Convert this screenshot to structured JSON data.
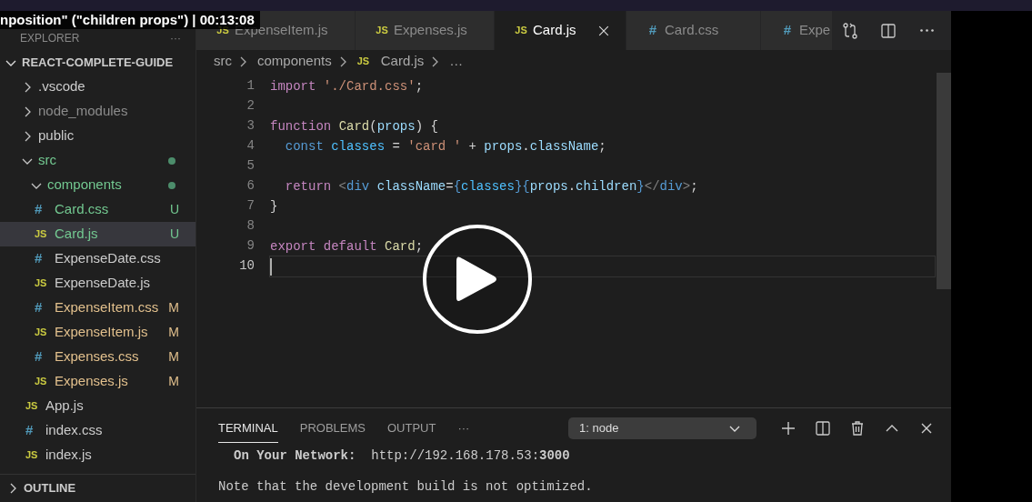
{
  "video_title": "nposition\" (\"children props\") | 00:13:08",
  "explorer": {
    "title": "EXPLORER",
    "more": "···",
    "project": {
      "name": "REACT-COMPLETE-GUIDE",
      "expanded": true,
      "children": [
        {
          "name": ".vscode",
          "kind": "folder",
          "expanded": false,
          "color": "#cccccc",
          "changes_dot": false,
          "selected": false
        },
        {
          "name": "node_modules",
          "kind": "folder",
          "expanded": false,
          "color": "#8c8c8c",
          "changes_dot": false,
          "selected": false
        },
        {
          "name": "public",
          "kind": "folder",
          "expanded": false,
          "color": "#cccccc",
          "changes_dot": false,
          "selected": false
        },
        {
          "name": "src",
          "kind": "folder",
          "expanded": true,
          "color": "#73c991",
          "changes_dot": true,
          "selected": false,
          "children": [
            {
              "name": "components",
              "kind": "folder",
              "expanded": true,
              "color": "#73c991",
              "changes_dot": true,
              "selected": false,
              "children": [
                {
                  "name": "Card.css",
                  "kind": "css",
                  "icon": "#",
                  "color": "#73c991",
                  "status": "U",
                  "selected": false
                },
                {
                  "name": "Card.js",
                  "kind": "js",
                  "icon": "JS",
                  "color": "#73c991",
                  "status": "U",
                  "selected": true
                },
                {
                  "name": "ExpenseDate.css",
                  "kind": "css",
                  "icon": "#",
                  "color": "#cccccc",
                  "selected": false
                },
                {
                  "name": "ExpenseDate.js",
                  "kind": "js",
                  "icon": "JS",
                  "color": "#cccccc",
                  "selected": false
                },
                {
                  "name": "ExpenseItem.css",
                  "kind": "css",
                  "icon": "#",
                  "color": "#e2c08d",
                  "status": "M",
                  "selected": false
                },
                {
                  "name": "ExpenseItem.js",
                  "kind": "js",
                  "icon": "JS",
                  "color": "#e2c08d",
                  "status": "M",
                  "selected": false
                },
                {
                  "name": "Expenses.css",
                  "kind": "css",
                  "icon": "#",
                  "color": "#e2c08d",
                  "status": "M",
                  "selected": false
                },
                {
                  "name": "Expenses.js",
                  "kind": "js",
                  "icon": "JS",
                  "color": "#e2c08d",
                  "status": "M",
                  "selected": false
                }
              ]
            },
            {
              "name": "App.js",
              "kind": "js",
              "icon": "JS",
              "color": "#cccccc",
              "selected": false
            },
            {
              "name": "index.css",
              "kind": "css",
              "icon": "#",
              "color": "#cccccc",
              "selected": false
            },
            {
              "name": "index.js",
              "kind": "js",
              "icon": "JS",
              "color": "#cccccc",
              "selected": false
            }
          ]
        }
      ]
    }
  },
  "outline": {
    "title": "OUTLINE",
    "expanded": false
  },
  "tabs": [
    {
      "label": "ExpenseItem.js",
      "kind": "js",
      "icon": "JS",
      "selected": false
    },
    {
      "label": "Expenses.js",
      "kind": "js",
      "icon": "JS",
      "selected": false
    },
    {
      "label": "Card.js",
      "kind": "js",
      "icon": "JS",
      "selected": true
    },
    {
      "label": "Card.css",
      "kind": "css",
      "icon": "#",
      "selected": false
    },
    {
      "label": "Expe",
      "kind": "css",
      "icon": "#",
      "selected": false
    }
  ],
  "breadcrumb": [
    {
      "label": "src"
    },
    {
      "label": "components"
    },
    {
      "label": "Card.js",
      "icon": "JS"
    },
    {
      "label": "…"
    }
  ],
  "code": [
    {
      "number": "1",
      "current": false,
      "indented": false,
      "tokens": [
        {
          "kind": "kw",
          "text": "import "
        },
        {
          "kind": "str",
          "text": "'./Card.css'"
        },
        {
          "kind": "plain",
          "text": ";"
        }
      ]
    },
    {
      "number": "2",
      "current": false
    },
    {
      "number": "3",
      "current": false,
      "indented": false,
      "tokens": [
        {
          "kind": "kw",
          "text": "function "
        },
        {
          "kind": "fn",
          "text": "Card"
        },
        {
          "kind": "plain",
          "text": "("
        },
        {
          "kind": "var",
          "text": "props"
        },
        {
          "kind": "plain",
          "text": ") {"
        }
      ]
    },
    {
      "number": "4",
      "current": false,
      "indented": true,
      "tokens": [
        {
          "kind": "decl",
          "text": "const "
        },
        {
          "kind": "const",
          "text": "classes"
        },
        {
          "kind": "plain",
          "text": " = "
        },
        {
          "kind": "str",
          "text": "'card '"
        },
        {
          "kind": "plain",
          "text": " + "
        },
        {
          "kind": "var",
          "text": "props"
        },
        {
          "kind": "plain",
          "text": "."
        },
        {
          "kind": "var",
          "text": "className"
        },
        {
          "kind": "plain",
          "text": ";"
        }
      ]
    },
    {
      "number": "5",
      "current": false
    },
    {
      "number": "6",
      "current": false,
      "indented": true,
      "tokens": [
        {
          "kind": "kw",
          "text": "return "
        },
        {
          "kind": "punct",
          "text": "<"
        },
        {
          "kind": "decl",
          "text": "div"
        },
        {
          "kind": "var",
          "text": " className"
        },
        {
          "kind": "plain",
          "text": "="
        },
        {
          "kind": "decl",
          "text": "{"
        },
        {
          "kind": "const",
          "text": "classes"
        },
        {
          "kind": "decl",
          "text": "}{"
        },
        {
          "kind": "var",
          "text": "props"
        },
        {
          "kind": "plain",
          "text": "."
        },
        {
          "kind": "var",
          "text": "children"
        },
        {
          "kind": "decl",
          "text": "}"
        },
        {
          "kind": "punct",
          "text": "</"
        },
        {
          "kind": "decl",
          "text": "div"
        },
        {
          "kind": "punct",
          "text": ">"
        },
        {
          "kind": "plain",
          "text": ";"
        }
      ]
    },
    {
      "number": "7",
      "current": false,
      "indented": false,
      "tokens": [
        {
          "kind": "plain",
          "text": "}"
        }
      ]
    },
    {
      "number": "8",
      "current": false
    },
    {
      "number": "9",
      "current": false,
      "indented": false,
      "tokens": [
        {
          "kind": "kw",
          "text": "export default "
        },
        {
          "kind": "fn",
          "text": "Card"
        },
        {
          "kind": "plain",
          "text": ";"
        }
      ]
    },
    {
      "number": "10",
      "current": true
    }
  ],
  "panel": {
    "tabs": [
      {
        "label": "TERMINAL",
        "selected": true
      },
      {
        "label": "PROBLEMS",
        "selected": false
      },
      {
        "label": "OUTPUT",
        "selected": false
      }
    ],
    "more": "···",
    "terminal_select": "1: node",
    "lines": [
      {
        "text": "**On Your Network:**  http://192.168.178.53:**3000**",
        "indented": true,
        "gap_before": false
      },
      {
        "text": "Note that the development build is not optimized.",
        "indented": false,
        "gap_before": true
      }
    ]
  }
}
